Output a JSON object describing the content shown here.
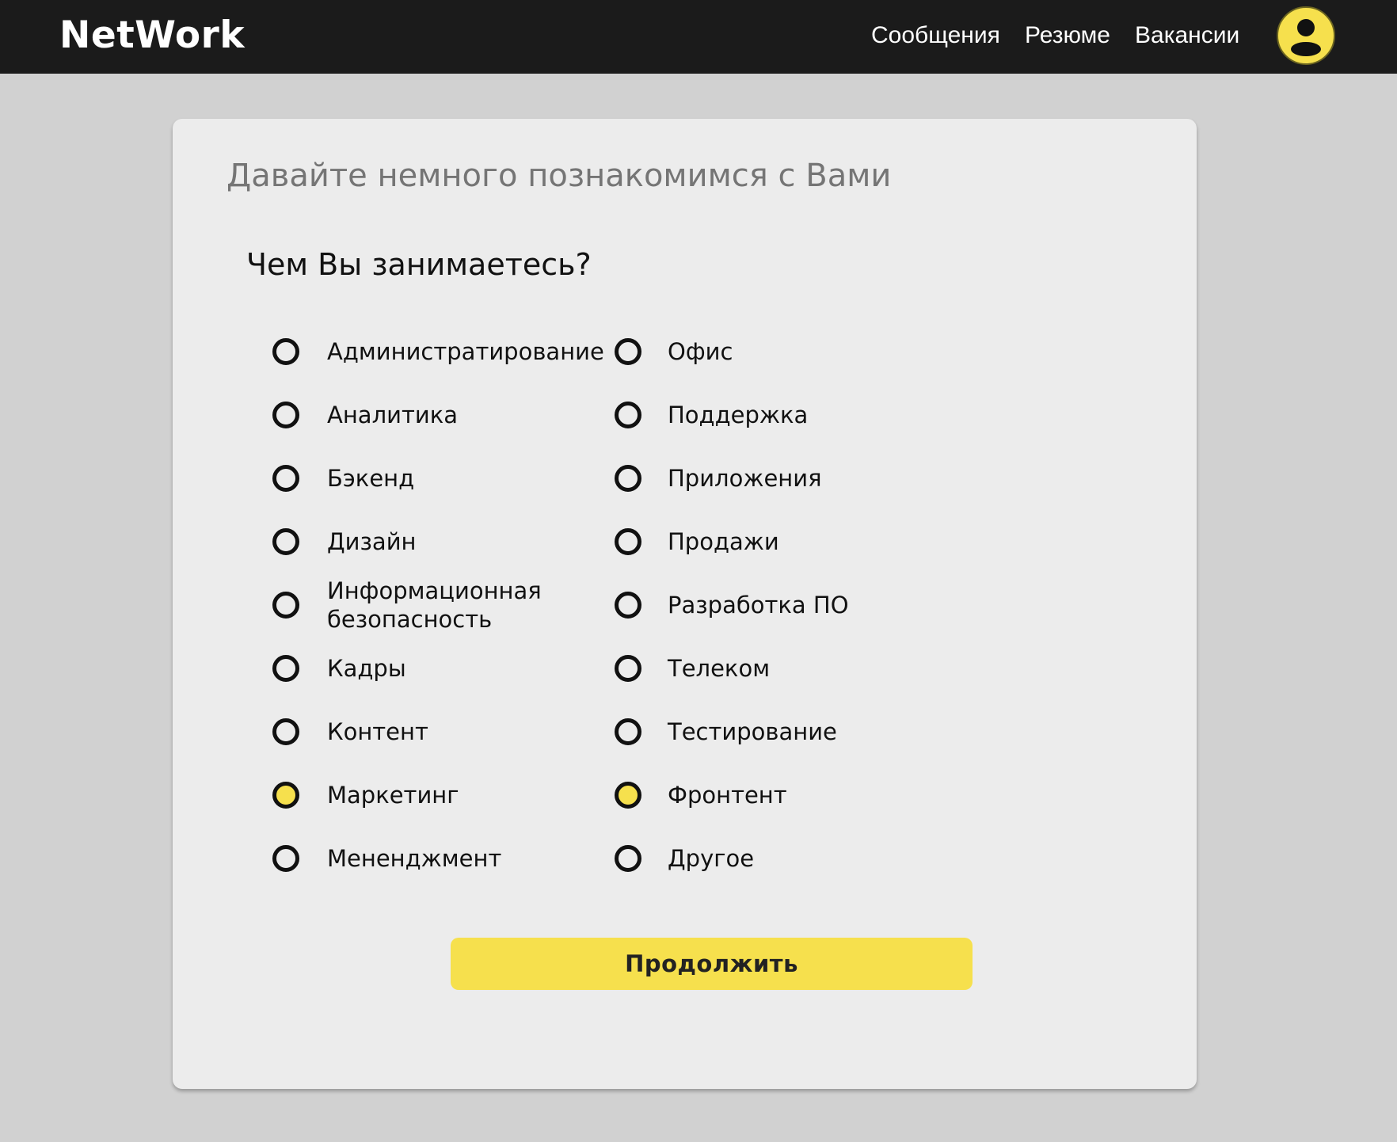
{
  "header": {
    "logo": "NetWork",
    "nav": [
      "Сообщения",
      "Резюме",
      "Вакансии"
    ],
    "avatar_icon": "user-icon"
  },
  "form": {
    "greeting": "Давайте немного познакомимся с Вами",
    "question": "Чем Вы занимаетесь?",
    "options": [
      {
        "label": "Администратирование",
        "checked": false
      },
      {
        "label": "Аналитика",
        "checked": false
      },
      {
        "label": "Бэкенд",
        "checked": false
      },
      {
        "label": "Дизайн",
        "checked": false
      },
      {
        "label": "Информационная",
        "label_line2": "безопасность",
        "checked": false
      },
      {
        "label": "Кадры",
        "checked": false
      },
      {
        "label": "Контент",
        "checked": false
      },
      {
        "label": "Маркетинг",
        "checked": true
      },
      {
        "label": "Мененджмент",
        "checked": false
      },
      {
        "label": "Офис",
        "checked": false
      },
      {
        "label": "Поддержка",
        "checked": false
      },
      {
        "label": "Приложения",
        "checked": false
      },
      {
        "label": "Продажи",
        "checked": false
      },
      {
        "label": "Разработка ПО",
        "checked": false
      },
      {
        "label": "Телеком",
        "checked": false
      },
      {
        "label": "Тестирование",
        "checked": false
      },
      {
        "label": "Фронтент",
        "checked": true
      },
      {
        "label": "Другое",
        "checked": false
      }
    ],
    "continue_label": "Продолжить"
  },
  "colors": {
    "accent": "#f6e04d",
    "topbar": "#1b1b1b",
    "background": "#d1d1d1",
    "card": "#ececec"
  }
}
